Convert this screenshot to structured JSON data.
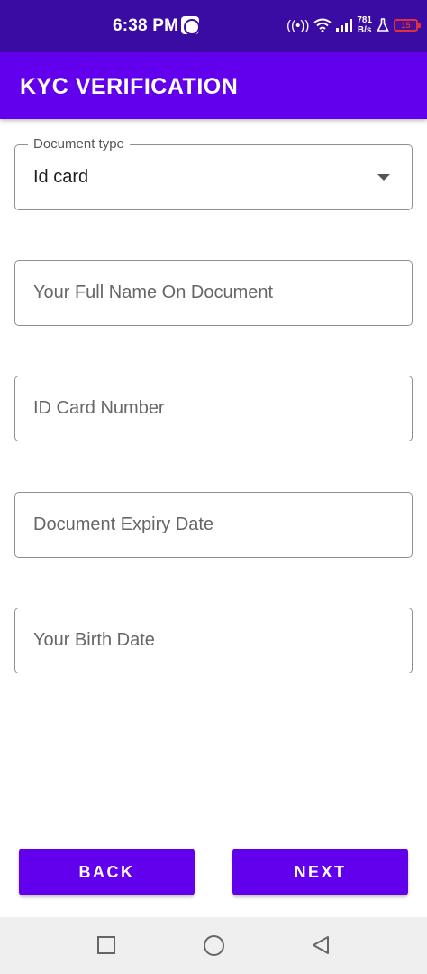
{
  "status_bar": {
    "time": "6:38 PM",
    "speed_value": "781",
    "speed_unit": "B/s",
    "battery": "15",
    "icons": [
      "notification-icon",
      "hotspot-icon",
      "wifi-icon",
      "signal-icon",
      "lab-icon",
      "battery-icon"
    ]
  },
  "app_bar": {
    "title": "KYC VERIFICATION"
  },
  "form": {
    "document_type": {
      "label": "Document type",
      "value": "Id card"
    },
    "full_name": {
      "placeholder": "Your Full Name On Document"
    },
    "id_number": {
      "placeholder": "ID Card Number"
    },
    "expiry_date": {
      "placeholder": "Document Expiry Date"
    },
    "birth_date": {
      "placeholder": "Your Birth Date"
    }
  },
  "buttons": {
    "back": "BACK",
    "next": "NEXT"
  },
  "nav_bar": {
    "icons": [
      "recents-icon",
      "home-icon",
      "back-icon"
    ]
  },
  "colors": {
    "status_bar": "#3a0ca3",
    "primary": "#6200ee",
    "battery_low": "#e0303a"
  }
}
